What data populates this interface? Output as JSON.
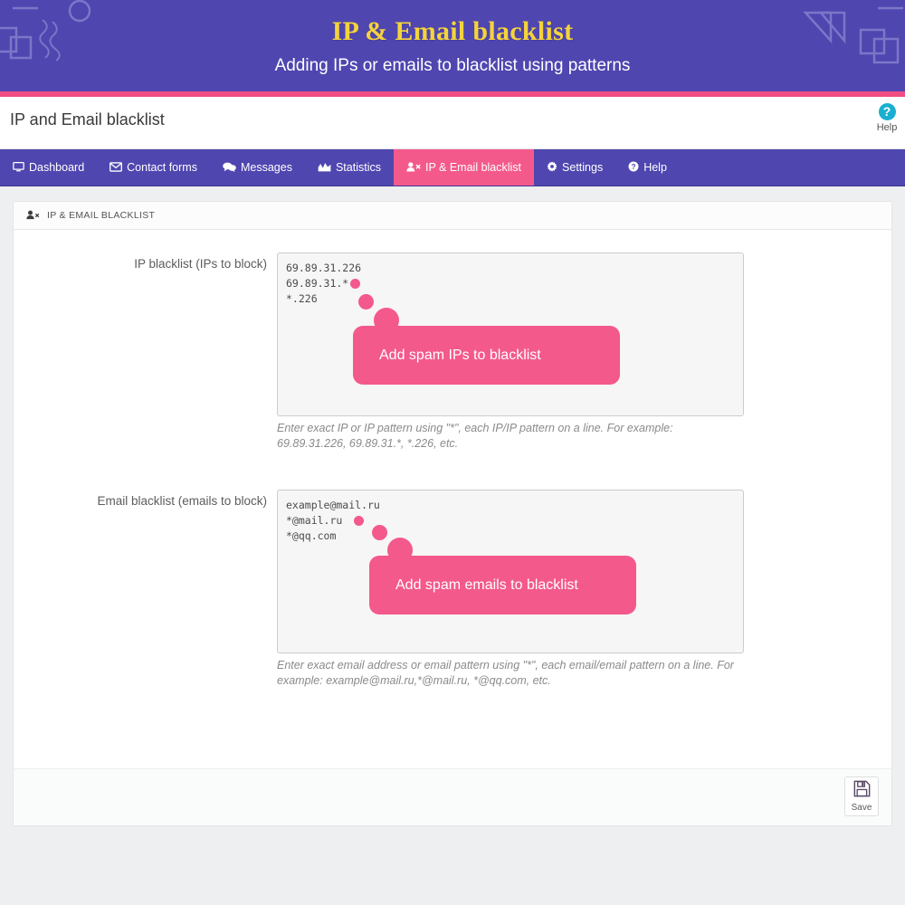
{
  "banner": {
    "title": "IP & Email blacklist",
    "subtitle": "Adding IPs or emails to blacklist using patterns",
    "bg_color": "#4f46b0",
    "title_color": "#f5d33c",
    "rule_color": "#ef4d84"
  },
  "titlebar": {
    "page_title": "IP and Email blacklist",
    "help_glyph": "?",
    "help_label": "Help",
    "help_color": "#1aafd0"
  },
  "nav": {
    "active_color": "#f4598c",
    "items": [
      {
        "label": "Dashboard",
        "icon": "display-icon",
        "glyph": "⎙",
        "active": false
      },
      {
        "label": "Contact forms",
        "icon": "envelope-icon",
        "glyph": "✉",
        "active": false
      },
      {
        "label": "Messages",
        "icon": "comments-icon",
        "glyph": "὞A",
        "active": false
      },
      {
        "label": "Statistics",
        "icon": "chart-area-icon",
        "glyph": "Ὄ8",
        "active": false
      },
      {
        "label": "IP & Email blacklist",
        "icon": "user-times-icon",
        "glyph": "὆4",
        "active": true
      },
      {
        "label": "Settings",
        "icon": "gear-icon",
        "glyph": "⚙",
        "active": false
      },
      {
        "label": "Help",
        "icon": "question-circle-icon",
        "glyph": "?",
        "active": false
      }
    ]
  },
  "panel": {
    "heading": "IP & EMAIL BLACKLIST",
    "heading_icon": "user-times-icon"
  },
  "fields": {
    "ip": {
      "label": "IP blacklist (IPs to block)",
      "value": "69.89.31.226\n69.89.31.*\n*.226",
      "help": "Enter exact IP or IP pattern using \"*\", each IP/IP pattern on a line. For example: 69.89.31.226, 69.89.31.*, *.226, etc.",
      "callout": "Add spam IPs to blacklist"
    },
    "email": {
      "label": "Email blacklist (emails to block)",
      "value": "example@mail.ru\n*@mail.ru\n*@qq.com",
      "help": "Enter exact email address or email pattern using \"*\", each email/email pattern on a line. For example: example@mail.ru,*@mail.ru, *@qq.com, etc.",
      "callout": "Add spam emails to blacklist"
    }
  },
  "footer": {
    "save_label": "Save",
    "save_icon": "floppy-disk-icon"
  }
}
